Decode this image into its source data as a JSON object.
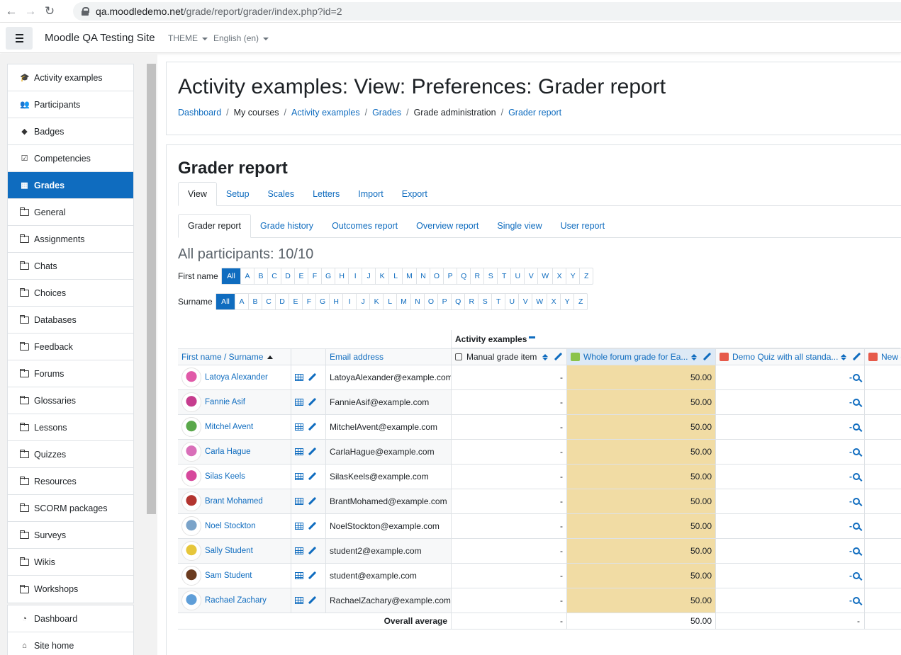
{
  "browser": {
    "url_host": "qa.moodledemo.net",
    "url_path": "/grade/report/grader/index.php?id=2"
  },
  "navbar": {
    "site_name": "Moodle QA Testing Site",
    "theme_menu": "THEME",
    "lang_menu": "English (en)"
  },
  "drawer": {
    "course_items": [
      {
        "label": "Activity examples",
        "icon": "graduation-cap-icon"
      },
      {
        "label": "Participants",
        "icon": "users-icon"
      },
      {
        "label": "Badges",
        "icon": "shield-icon"
      },
      {
        "label": "Competencies",
        "icon": "checkbox-icon"
      },
      {
        "label": "Grades",
        "icon": "table-icon",
        "active": true
      },
      {
        "label": "General",
        "icon": "folder-icon"
      },
      {
        "label": "Assignments",
        "icon": "folder-icon"
      },
      {
        "label": "Chats",
        "icon": "folder-icon"
      },
      {
        "label": "Choices",
        "icon": "folder-icon"
      },
      {
        "label": "Databases",
        "icon": "folder-icon"
      },
      {
        "label": "Feedback",
        "icon": "folder-icon"
      },
      {
        "label": "Forums",
        "icon": "folder-icon"
      },
      {
        "label": "Glossaries",
        "icon": "folder-icon"
      },
      {
        "label": "Lessons",
        "icon": "folder-icon"
      },
      {
        "label": "Quizzes",
        "icon": "folder-icon"
      },
      {
        "label": "Resources",
        "icon": "folder-icon"
      },
      {
        "label": "SCORM packages",
        "icon": "folder-icon"
      },
      {
        "label": "Surveys",
        "icon": "folder-icon"
      },
      {
        "label": "Wikis",
        "icon": "folder-icon"
      },
      {
        "label": "Workshops",
        "icon": "folder-icon"
      }
    ],
    "site_items": [
      {
        "label": "Dashboard",
        "icon": "dashboard-icon"
      },
      {
        "label": "Site home",
        "icon": "home-icon"
      }
    ]
  },
  "header": {
    "title": "Activity examples: View: Preferences: Grader report",
    "breadcrumb": [
      {
        "label": "Dashboard",
        "link": true
      },
      {
        "label": "My courses",
        "link": false
      },
      {
        "label": "Activity examples",
        "link": true
      },
      {
        "label": "Grades",
        "link": true
      },
      {
        "label": "Grade administration",
        "link": false
      },
      {
        "label": "Grader report",
        "link": true
      }
    ]
  },
  "report": {
    "heading": "Grader report",
    "main_tabs": [
      "View",
      "Setup",
      "Scales",
      "Letters",
      "Import",
      "Export"
    ],
    "sub_tabs": [
      "Grader report",
      "Grade history",
      "Outcomes report",
      "Overview report",
      "Single view",
      "User report"
    ],
    "participants": "All participants: 10/10",
    "firstname_label": "First name",
    "surname_label": "Surname",
    "all_label": "All",
    "letters": [
      "A",
      "B",
      "C",
      "D",
      "E",
      "F",
      "G",
      "H",
      "I",
      "J",
      "K",
      "L",
      "M",
      "N",
      "O",
      "P",
      "Q",
      "R",
      "S",
      "T",
      "U",
      "V",
      "W",
      "X",
      "Y",
      "Z"
    ]
  },
  "grader": {
    "category": "Activity examples",
    "headers": {
      "name": "First name / Surname",
      "email": "Email address",
      "item1": "Manual grade item",
      "item2": "Whole forum grade for Ea...",
      "item3": "Demo Quiz with all standa...",
      "item4": "New c"
    },
    "rows": [
      {
        "name": "Latoya Alexander",
        "email": "LatoyaAlexander@example.com",
        "g1": "-",
        "g2": "50.00",
        "g3": "-",
        "avatar_color": "#e05aa8"
      },
      {
        "name": "Fannie Asif",
        "email": "FannieAsif@example.com",
        "g1": "-",
        "g2": "50.00",
        "g3": "-",
        "avatar_color": "#c63c8e"
      },
      {
        "name": "Mitchel Avent",
        "email": "MitchelAvent@example.com",
        "g1": "-",
        "g2": "50.00",
        "g3": "-",
        "avatar_color": "#5aa84b"
      },
      {
        "name": "Carla Hague",
        "email": "CarlaHague@example.com",
        "g1": "-",
        "g2": "50.00",
        "g3": "-",
        "avatar_color": "#d96fb9"
      },
      {
        "name": "Silas Keels",
        "email": "SilasKeels@example.com",
        "g1": "-",
        "g2": "50.00",
        "g3": "-",
        "avatar_color": "#d6489c"
      },
      {
        "name": "Brant Mohamed",
        "email": "BrantMohamed@example.com",
        "g1": "-",
        "g2": "50.00",
        "g3": "-",
        "avatar_color": "#b3342f"
      },
      {
        "name": "Noel Stockton",
        "email": "NoelStockton@example.com",
        "g1": "-",
        "g2": "50.00",
        "g3": "-",
        "avatar_color": "#7aa3c9"
      },
      {
        "name": "Sally Student",
        "email": "student2@example.com",
        "g1": "-",
        "g2": "50.00",
        "g3": "-",
        "avatar_color": "#e6c63a"
      },
      {
        "name": "Sam Student",
        "email": "student@example.com",
        "g1": "-",
        "g2": "50.00",
        "g3": "-",
        "avatar_color": "#6b3b1f"
      },
      {
        "name": "Rachael Zachary",
        "email": "RachaelZachary@example.com",
        "g1": "-",
        "g2": "50.00",
        "g3": "-",
        "avatar_color": "#5f9ed8"
      }
    ],
    "overall_label": "Overall average",
    "overall": {
      "g1": "-",
      "g2": "50.00",
      "g3": "-"
    }
  },
  "colors": {
    "accent": "#0f6cbf",
    "highlight_column": "#f1dca4"
  }
}
